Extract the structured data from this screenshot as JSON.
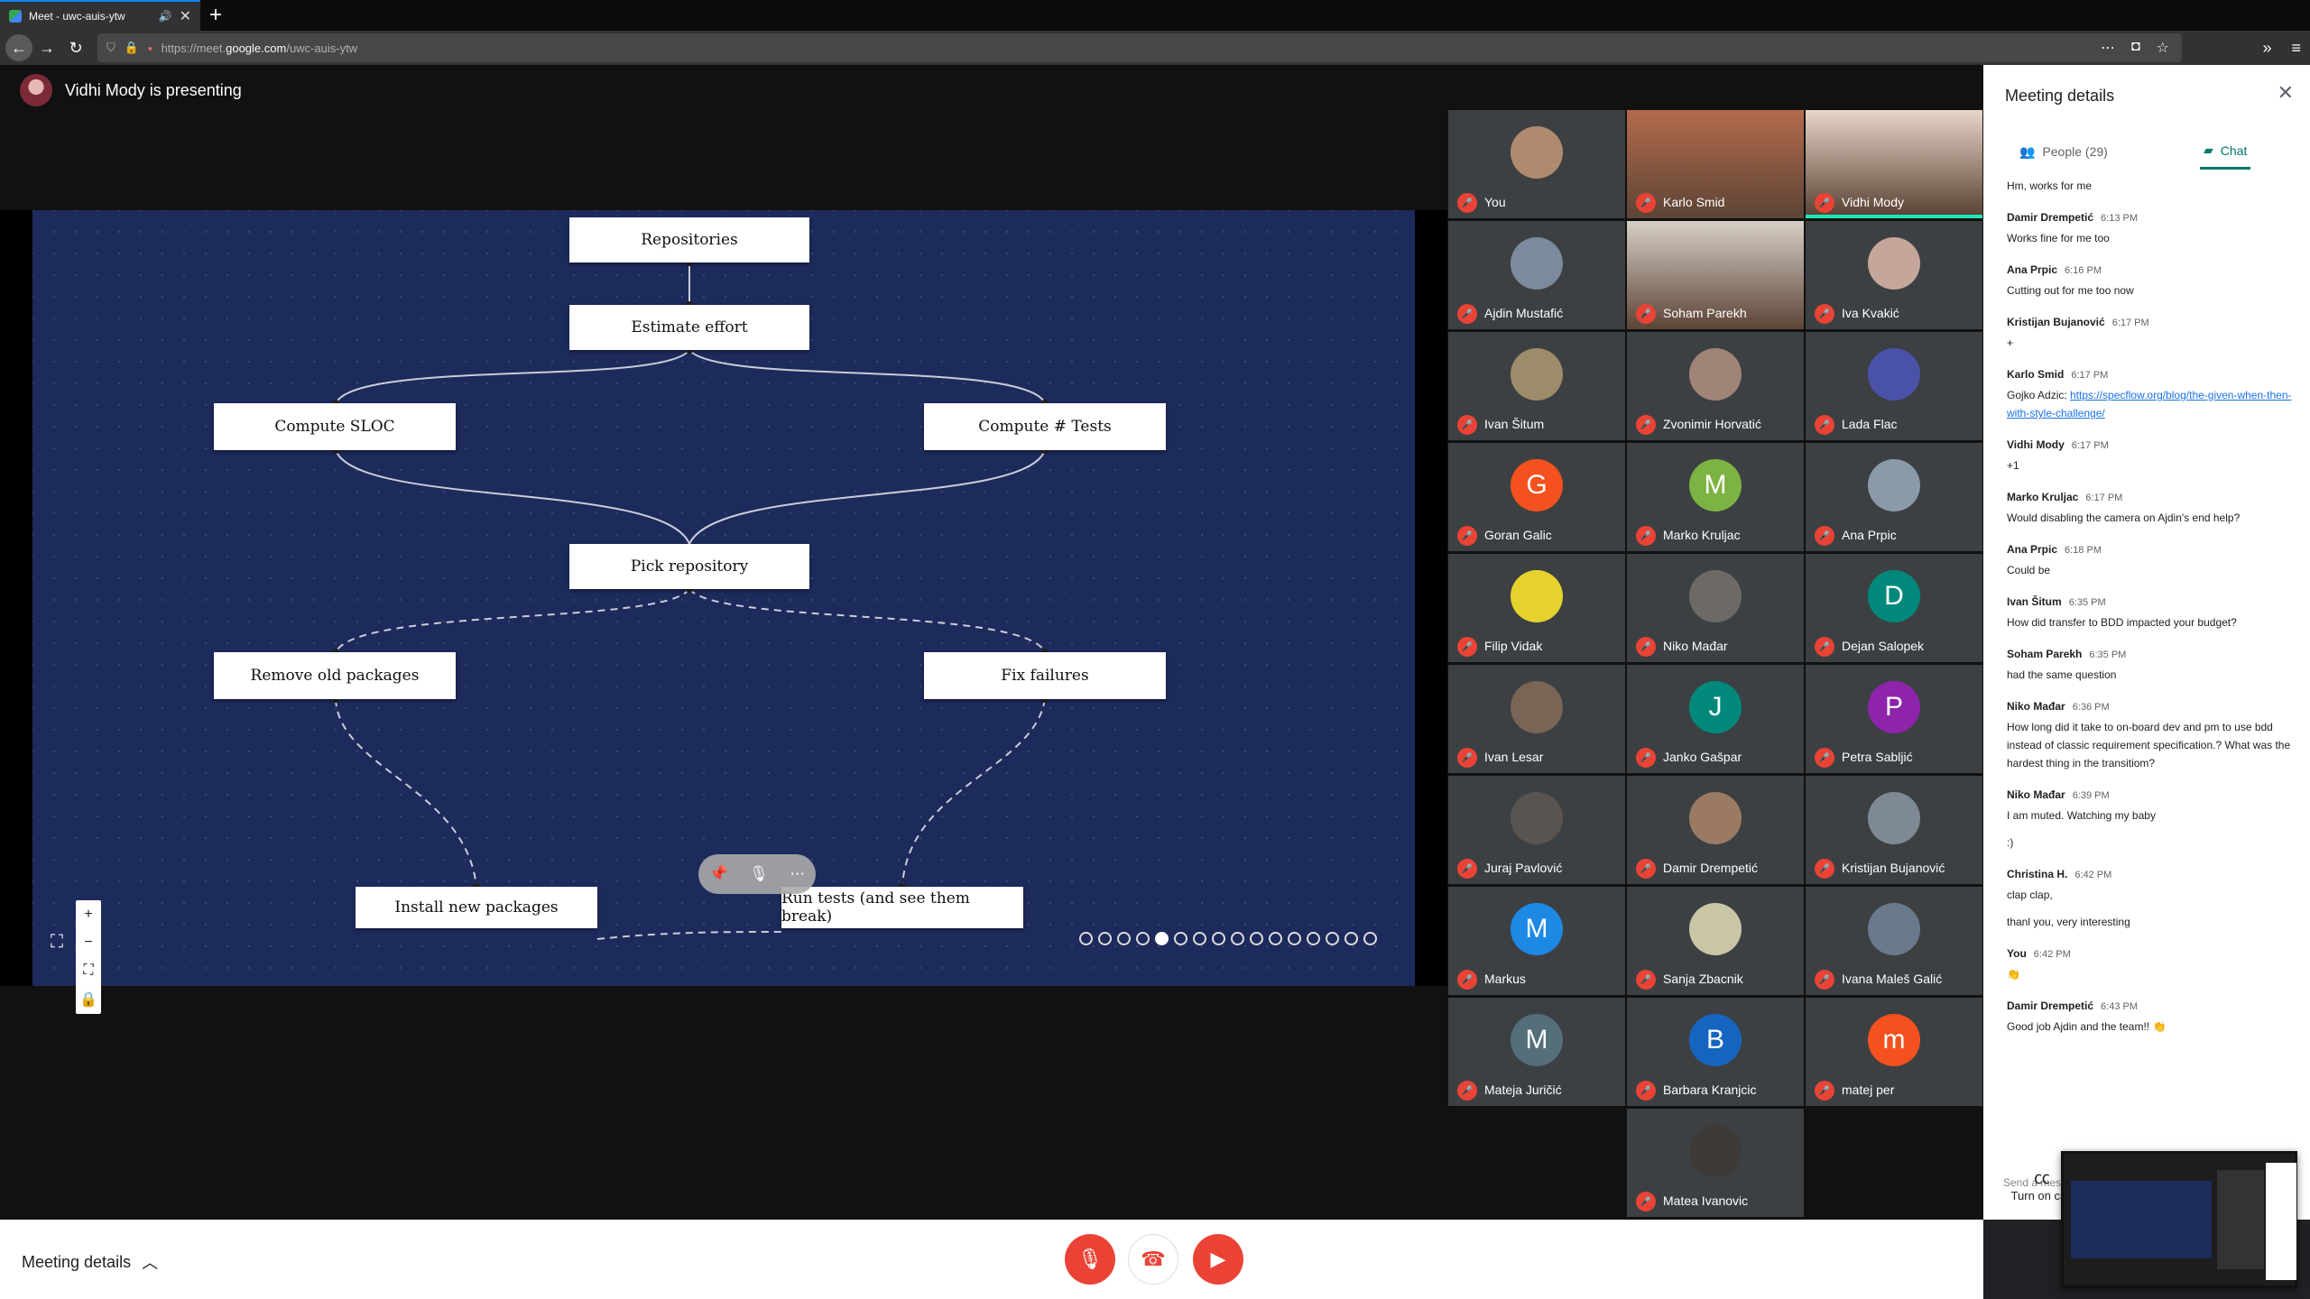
{
  "browser": {
    "tab_title": "Meet - uwc-auis-ytw",
    "url_prefix": "https://meet.",
    "url_domain": "google.com",
    "url_path": "/uwc-auis-ytw"
  },
  "stage": {
    "presenting_text": "Vidhi Mody is presenting"
  },
  "slide": {
    "nodes": {
      "repositories": "Repositories",
      "estimate": "Estimate effort",
      "sloc": "Compute SLOC",
      "tests": "Compute # Tests",
      "pick": "Pick repository",
      "remove": "Remove old packages",
      "fix": "Fix failures",
      "install": "Install new packages",
      "run": "Run tests (and see them break)"
    },
    "zoom_controls": [
      "+",
      "−",
      "⛶",
      "🔒"
    ]
  },
  "participants": [
    {
      "name": "You",
      "avatar": "photo",
      "color": "#b08a6f"
    },
    {
      "name": "Karlo Smid",
      "avatar": "video",
      "color": "#b46a4d"
    },
    {
      "name": "Vidhi Mody",
      "avatar": "video",
      "color": "#e8d6c8",
      "active": true
    },
    {
      "name": "Ajdin Mustafić",
      "avatar": "photo",
      "color": "#7b8a9c"
    },
    {
      "name": "Soham Parekh",
      "avatar": "video",
      "color": "#d7cfc6"
    },
    {
      "name": "Iva Kvakić",
      "avatar": "photo",
      "color": "#c4a69a"
    },
    {
      "name": "Ivan Šitum",
      "avatar": "photo",
      "color": "#9d8c6a"
    },
    {
      "name": "Zvonimir Horvatić",
      "avatar": "photo",
      "color": "#a08477"
    },
    {
      "name": "Lada Flac",
      "avatar": "photo",
      "color": "#4a52a8"
    },
    {
      "name": "Goran Galic",
      "avatar": "letter",
      "letter": "G",
      "color": "#f4511e"
    },
    {
      "name": "Marko Kruljac",
      "avatar": "letter",
      "letter": "M",
      "color": "#7cb342"
    },
    {
      "name": "Ana Prpic",
      "avatar": "photo",
      "color": "#8a9aa8"
    },
    {
      "name": "Filip Vidak",
      "avatar": "photo",
      "color": "#e6d22d"
    },
    {
      "name": "Niko Mađar",
      "avatar": "photo",
      "color": "#6d6a66"
    },
    {
      "name": "Dejan Salopek",
      "avatar": "letter",
      "letter": "D",
      "color": "#00897b"
    },
    {
      "name": "Ivan Lesar",
      "avatar": "photo",
      "color": "#7a6455"
    },
    {
      "name": "Janko Gašpar",
      "avatar": "letter",
      "letter": "J",
      "color": "#00897b"
    },
    {
      "name": "Petra Sabljić",
      "avatar": "letter",
      "letter": "P",
      "color": "#8e24aa"
    },
    {
      "name": "Juraj Pavlović",
      "avatar": "photo",
      "color": "#5a5450"
    },
    {
      "name": "Damir Drempetić",
      "avatar": "photo",
      "color": "#9a7a62"
    },
    {
      "name": "Kristijan Bujanović",
      "avatar": "photo",
      "color": "#7f8994"
    },
    {
      "name": "Markus",
      "avatar": "letter",
      "letter": "M",
      "color": "#1e88e5"
    },
    {
      "name": "Sanja Zbacnik",
      "avatar": "photo",
      "color": "#c8c6a4"
    },
    {
      "name": "Ivana Maleš Galić",
      "avatar": "photo",
      "color": "#6a7a8c"
    },
    {
      "name": "Mateja Juričić",
      "avatar": "letter",
      "letter": "M",
      "color": "#546e7a"
    },
    {
      "name": "Barbara Kranjcic",
      "avatar": "letter",
      "letter": "B",
      "color": "#1565c0"
    },
    {
      "name": "matej per",
      "avatar": "letter",
      "letter": "m",
      "color": "#f4511e"
    },
    {
      "name": "Matea Ivanovic",
      "avatar": "photo",
      "color": "#3e3a38"
    }
  ],
  "panel": {
    "title": "Meeting details",
    "people_tab": "People (29)",
    "chat_tab": "Chat",
    "send_placeholder": "Send a mes",
    "captions": "Turn on cap"
  },
  "chat": [
    {
      "who": "",
      "time": "",
      "lines": [
        "Hm, works for me"
      ]
    },
    {
      "who": "Damir Drempetić",
      "time": "6:13 PM",
      "lines": [
        "Works fine for me too"
      ]
    },
    {
      "who": "Ana Prpic",
      "time": "6:16 PM",
      "lines": [
        "Cutting out for me too now"
      ]
    },
    {
      "who": "Kristijan Bujanović",
      "time": "6:17 PM",
      "lines": [
        "+"
      ]
    },
    {
      "who": "Karlo Smid",
      "time": "6:17 PM",
      "prefix": "Gojko Adzic: ",
      "link": "https://specflow.org/blog/the-given-when-then-with-style-challenge/"
    },
    {
      "who": "Vidhi Mody",
      "time": "6:17 PM",
      "lines": [
        "+1"
      ]
    },
    {
      "who": "Marko Kruljac",
      "time": "6:17 PM",
      "lines": [
        "Would disabling the camera on Ajdin's end help?"
      ]
    },
    {
      "who": "Ana Prpic",
      "time": "6:18 PM",
      "lines": [
        "Could be"
      ]
    },
    {
      "who": "Ivan Šitum",
      "time": "6:35 PM",
      "lines": [
        "How did transfer to BDD impacted your budget?"
      ]
    },
    {
      "who": "Soham Parekh",
      "time": "6:35 PM",
      "lines": [
        "had the same question"
      ]
    },
    {
      "who": "Niko Mađar",
      "time": "6:36 PM",
      "lines": [
        "How long did it take to on-board dev and pm to use bdd instead of classic requirement specification.? What was the hardest thing in the transitiom?"
      ]
    },
    {
      "who": "Niko Mađar",
      "time": "6:39 PM",
      "lines": [
        "I am muted. Watching my baby",
        ":)"
      ]
    },
    {
      "who": "Christina H.",
      "time": "6:42 PM",
      "lines": [
        "clap clap,",
        "thanl you, very interesting"
      ]
    },
    {
      "who": "You",
      "time": "6:42 PM",
      "lines": [
        "👏"
      ]
    },
    {
      "who": "Damir Drempetić",
      "time": "6:43 PM",
      "lines": [
        "Good job Ajdin and the team!! 👏"
      ]
    }
  ],
  "bottombar": {
    "meeting_details": "Meeting details"
  },
  "colors": {
    "slide_bg": "#1d2a5c",
    "accent_chat": "#00796b",
    "danger": "#ea4335",
    "active_speaker": "#1de9b6"
  }
}
